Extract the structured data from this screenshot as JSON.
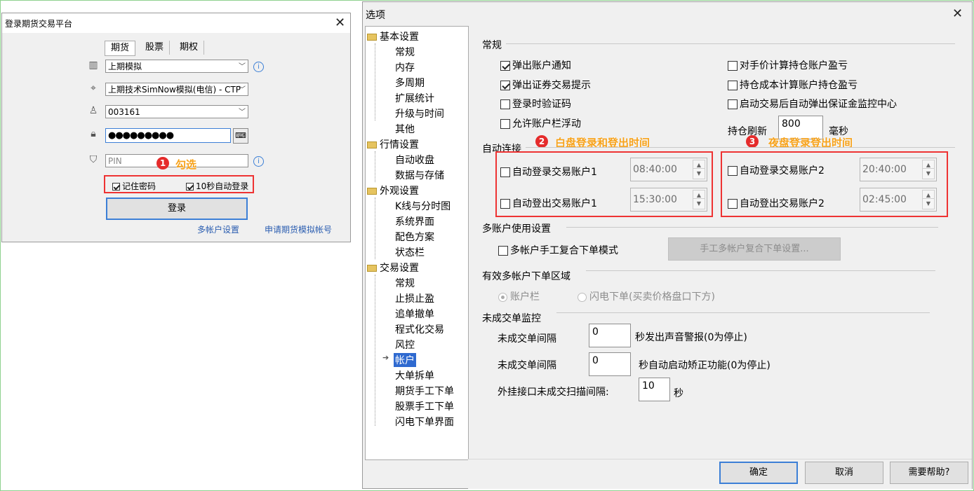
{
  "login": {
    "title": "登录期货交易平台",
    "tabs": [
      "期货",
      "股票",
      "期权"
    ],
    "broker": "上期模拟",
    "server": "上期技术SimNow模拟(电信) - CTP",
    "account": "003161",
    "password": "●●●●●●●●●",
    "pin_placeholder": "PIN",
    "remember_password": "记住密码",
    "auto_login": "10秒自动登录",
    "login_button": "登录",
    "multi_account_link": "多帐户设置",
    "apply_link": "申请期货模拟帐号"
  },
  "annotations": [
    {
      "num": "1",
      "text": "勾选"
    },
    {
      "num": "2",
      "text": "白盘登录和登出时间"
    },
    {
      "num": "3",
      "text": "夜盘登录登出时间"
    }
  ],
  "options": {
    "title": "选项",
    "tree": [
      {
        "label": "基本设置",
        "children": [
          "常规",
          "内存",
          "多周期",
          "扩展统计",
          "升级与时间",
          "其他"
        ]
      },
      {
        "label": "行情设置",
        "children": [
          "自动收盘",
          "数据与存储"
        ]
      },
      {
        "label": "外观设置",
        "children": [
          "K线与分时图",
          "系统界面",
          "配色方案",
          "状态栏"
        ]
      },
      {
        "label": "交易设置",
        "children": [
          "常规",
          "止损止盈",
          "追单撤单",
          "程式化交易",
          "风控",
          "帐户",
          "大单拆单",
          "期货手工下单",
          "股票手工下单",
          "闪电下单界面"
        ]
      }
    ],
    "selected_item": "帐户",
    "general": {
      "heading": "常规",
      "left": [
        {
          "label": "弹出账户通知",
          "checked": true
        },
        {
          "label": "弹出证券交易提示",
          "checked": true
        },
        {
          "label": "登录时验证码",
          "checked": false
        },
        {
          "label": "允许账户栏浮动",
          "checked": false
        }
      ],
      "right": [
        {
          "label": "对手价计算持仓账户盈亏",
          "checked": false
        },
        {
          "label": "持仓成本计算账户持仓盈亏",
          "checked": false
        },
        {
          "label": "启动交易后自动弹出保证金监控中心",
          "checked": false
        }
      ],
      "refresh_label": "持仓刷新",
      "refresh_value": "800",
      "refresh_unit": "毫秒"
    },
    "autoconnect": {
      "heading": "自动连接",
      "login1": "自动登录交易账户1",
      "login1_time": "08:40:00",
      "logout1": "自动登出交易账户1",
      "logout1_time": "15:30:00",
      "login2": "自动登录交易账户2",
      "login2_time": "20:40:00",
      "logout2": "自动登出交易账户2",
      "logout2_time": "02:45:00"
    },
    "multi": {
      "heading": "多账户使用设置",
      "manual_mode": "多帐户手工复合下单模式",
      "manual_settings": "手工多帐户复合下单设置..."
    },
    "valid_area": {
      "heading": "有效多帐户下单区域",
      "opt1": "账户栏",
      "opt2": "闪电下单(买卖价格盘口下方)"
    },
    "unfilled": {
      "heading": "未成交单监控",
      "row1_label": "未成交单间隔",
      "row1_value": "0",
      "row1_suffix": "秒发出声音警报(0为停止)",
      "row2_label": "未成交单间隔",
      "row2_value": "0",
      "row2_suffix": "秒自动启动矫正功能(0为停止)",
      "row3_label": "外挂接口未成交扫描间隔:",
      "row3_value": "10",
      "row3_suffix": "秒"
    },
    "buttons": {
      "ok": "确定",
      "cancel": "取消",
      "help": "需要帮助?"
    }
  }
}
